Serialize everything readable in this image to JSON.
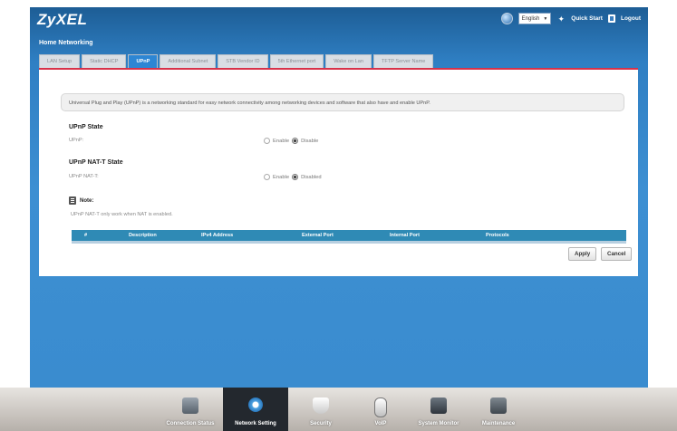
{
  "header": {
    "logo": "ZyXEL",
    "language": "English",
    "quick_start": "Quick Start",
    "logout": "Logout"
  },
  "section_title": "Home Networking",
  "tabs": [
    {
      "label": "LAN Setup",
      "active": false
    },
    {
      "label": "Static DHCP",
      "active": false
    },
    {
      "label": "UPnP",
      "active": true
    },
    {
      "label": "Additional Subnet",
      "active": false
    },
    {
      "label": "STB Vendor ID",
      "active": false
    },
    {
      "label": "5th Ethernet port",
      "active": false
    },
    {
      "label": "Wake on Lan",
      "active": false
    },
    {
      "label": "TFTP Server Name",
      "active": false
    }
  ],
  "info_text": "Universal Plug and Play (UPnP) is a networking standard for easy network connectivity among networking devices and software that also have and enable UPnP.",
  "upnp_state": {
    "title": "UPnP State",
    "label": "UPnP:",
    "enable_label": "Enable",
    "disable_label": "Disable",
    "selected": "Disable"
  },
  "upnp_nat_t_state": {
    "title": "UPnP NAT-T State",
    "label": "UPnP NAT-T:",
    "enable_label": "Enable",
    "disable_label": "Disabled",
    "selected": "Disabled"
  },
  "note": {
    "title": "Note:",
    "text": "UPnP NAT-T only work when NAT is enabled."
  },
  "table": {
    "columns": [
      "#",
      "Description",
      "IPv4 Address",
      "External Port",
      "Internal Port",
      "Protocols"
    ],
    "rows": []
  },
  "buttons": {
    "apply": "Apply",
    "cancel": "Cancel"
  },
  "dock": [
    {
      "label": "Connection Status",
      "icon": "connection-status-icon",
      "active": false
    },
    {
      "label": "Network Setting",
      "icon": "network-setting-icon",
      "active": true
    },
    {
      "label": "Security",
      "icon": "security-shield-icon",
      "active": false
    },
    {
      "label": "VoIP",
      "icon": "voip-phone-icon",
      "active": false
    },
    {
      "label": "System Monitor",
      "icon": "system-monitor-icon",
      "active": false
    },
    {
      "label": "Maintenance",
      "icon": "maintenance-icon",
      "active": false
    }
  ],
  "colors": {
    "frame_blue": "#3a8ccf",
    "active_tab": "#2d86d4",
    "accent_red": "#d8324a",
    "table_header": "#2f8ab5"
  }
}
